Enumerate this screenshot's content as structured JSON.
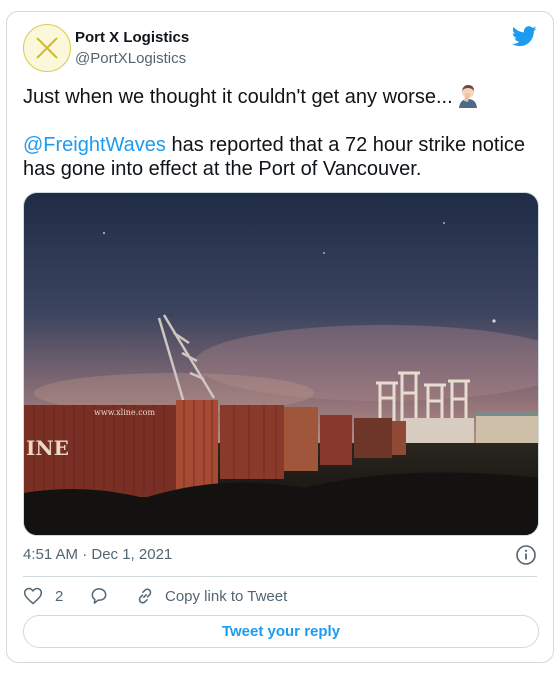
{
  "author": {
    "name": "Port X Logistics",
    "handle": "@PortXLogistics"
  },
  "tweet": {
    "line1": "Just when we thought it couldn't get any worse...",
    "mention": "@FreightWaves",
    "line2_rest": " has reported that a 72 hour strike notice has gone into effect at the Port of Vancouver."
  },
  "media": {
    "container_text": "www.xline.com",
    "container_side_text": "INE"
  },
  "meta": {
    "timestamp": "4:51 AM · Dec 1, 2021"
  },
  "actions": {
    "like_count": "2",
    "copy_link_label": "Copy link to Tweet",
    "reply_button_label": "Tweet your reply"
  },
  "colors": {
    "accent": "#1d9bf0",
    "text_secondary": "#536471",
    "border": "#cfd9de"
  }
}
